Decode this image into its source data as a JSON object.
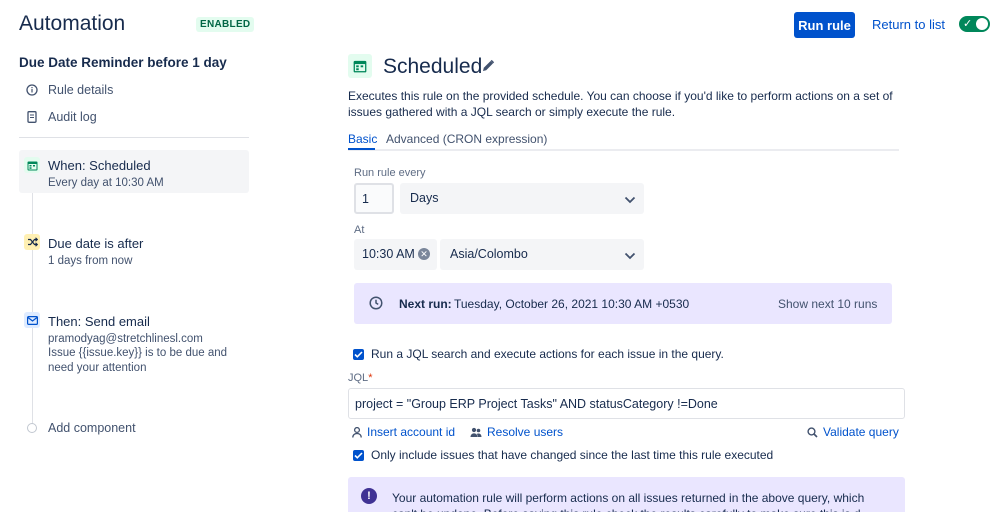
{
  "header": {
    "title": "Automation",
    "status_badge": "ENABLED",
    "run_rule_label": "Run rule",
    "return_label": "Return to list",
    "enabled_toggle_on": true
  },
  "sidebar": {
    "rule_name": "Due Date Reminder before 1 day",
    "links": [
      {
        "label": "Rule details",
        "icon": "info-icon"
      },
      {
        "label": "Audit log",
        "icon": "document-icon"
      }
    ],
    "steps": [
      {
        "title": "When: Scheduled",
        "subtitle": "Every day at 10:30 AM",
        "icon": "calendar-icon",
        "color": "#00875a"
      },
      {
        "title": "Due date is after",
        "subtitle": "1 days from now",
        "icon": "shuffle-icon",
        "color": "#ffab00"
      },
      {
        "title": "Then: Send email",
        "subtitle_lines": [
          "pramodyag@stretchlinesl.com",
          "Issue {{issue.key}} is to be due and need your attention"
        ],
        "icon": "mail-icon",
        "color": "#0065ff"
      }
    ],
    "add_component_label": "Add component"
  },
  "main": {
    "title": "Scheduled",
    "description": "Executes this rule on the provided schedule. You can choose if you'd like to perform actions on a set of issues gathered with a JQL search or simply execute the rule.",
    "tabs": [
      {
        "label": "Basic",
        "active": true
      },
      {
        "label": "Advanced (CRON expression)",
        "active": false
      }
    ],
    "run_every_label": "Run rule every",
    "run_every_value": "1",
    "run_every_unit": "Days",
    "at_label": "At",
    "at_time": "10:30 AM",
    "timezone": "Asia/Colombo",
    "next_run_label": "Next run:",
    "next_run_value": "Tuesday, October 26, 2021 10:30 AM +0530",
    "show_next_label": "Show next 10 runs",
    "jql_checkbox_label": "Run a JQL search and execute actions for each issue in the query.",
    "jql_checkbox_checked": true,
    "jql_label": "JQL",
    "jql_required_mark": "*",
    "jql_value": "project = \"Group ERP Project Tasks\" AND statusCategory !=Done",
    "insert_account_label": "Insert account id",
    "resolve_users_label": "Resolve users",
    "validate_query_label": "Validate query",
    "only_changed_label": "Only include issues that have changed since the last time this rule executed",
    "only_changed_checked": true,
    "info_text": "Your automation rule will perform actions on all issues returned in the above query, which can't be undone. Before saving this rule check the results carefully to make sure this is d..."
  }
}
